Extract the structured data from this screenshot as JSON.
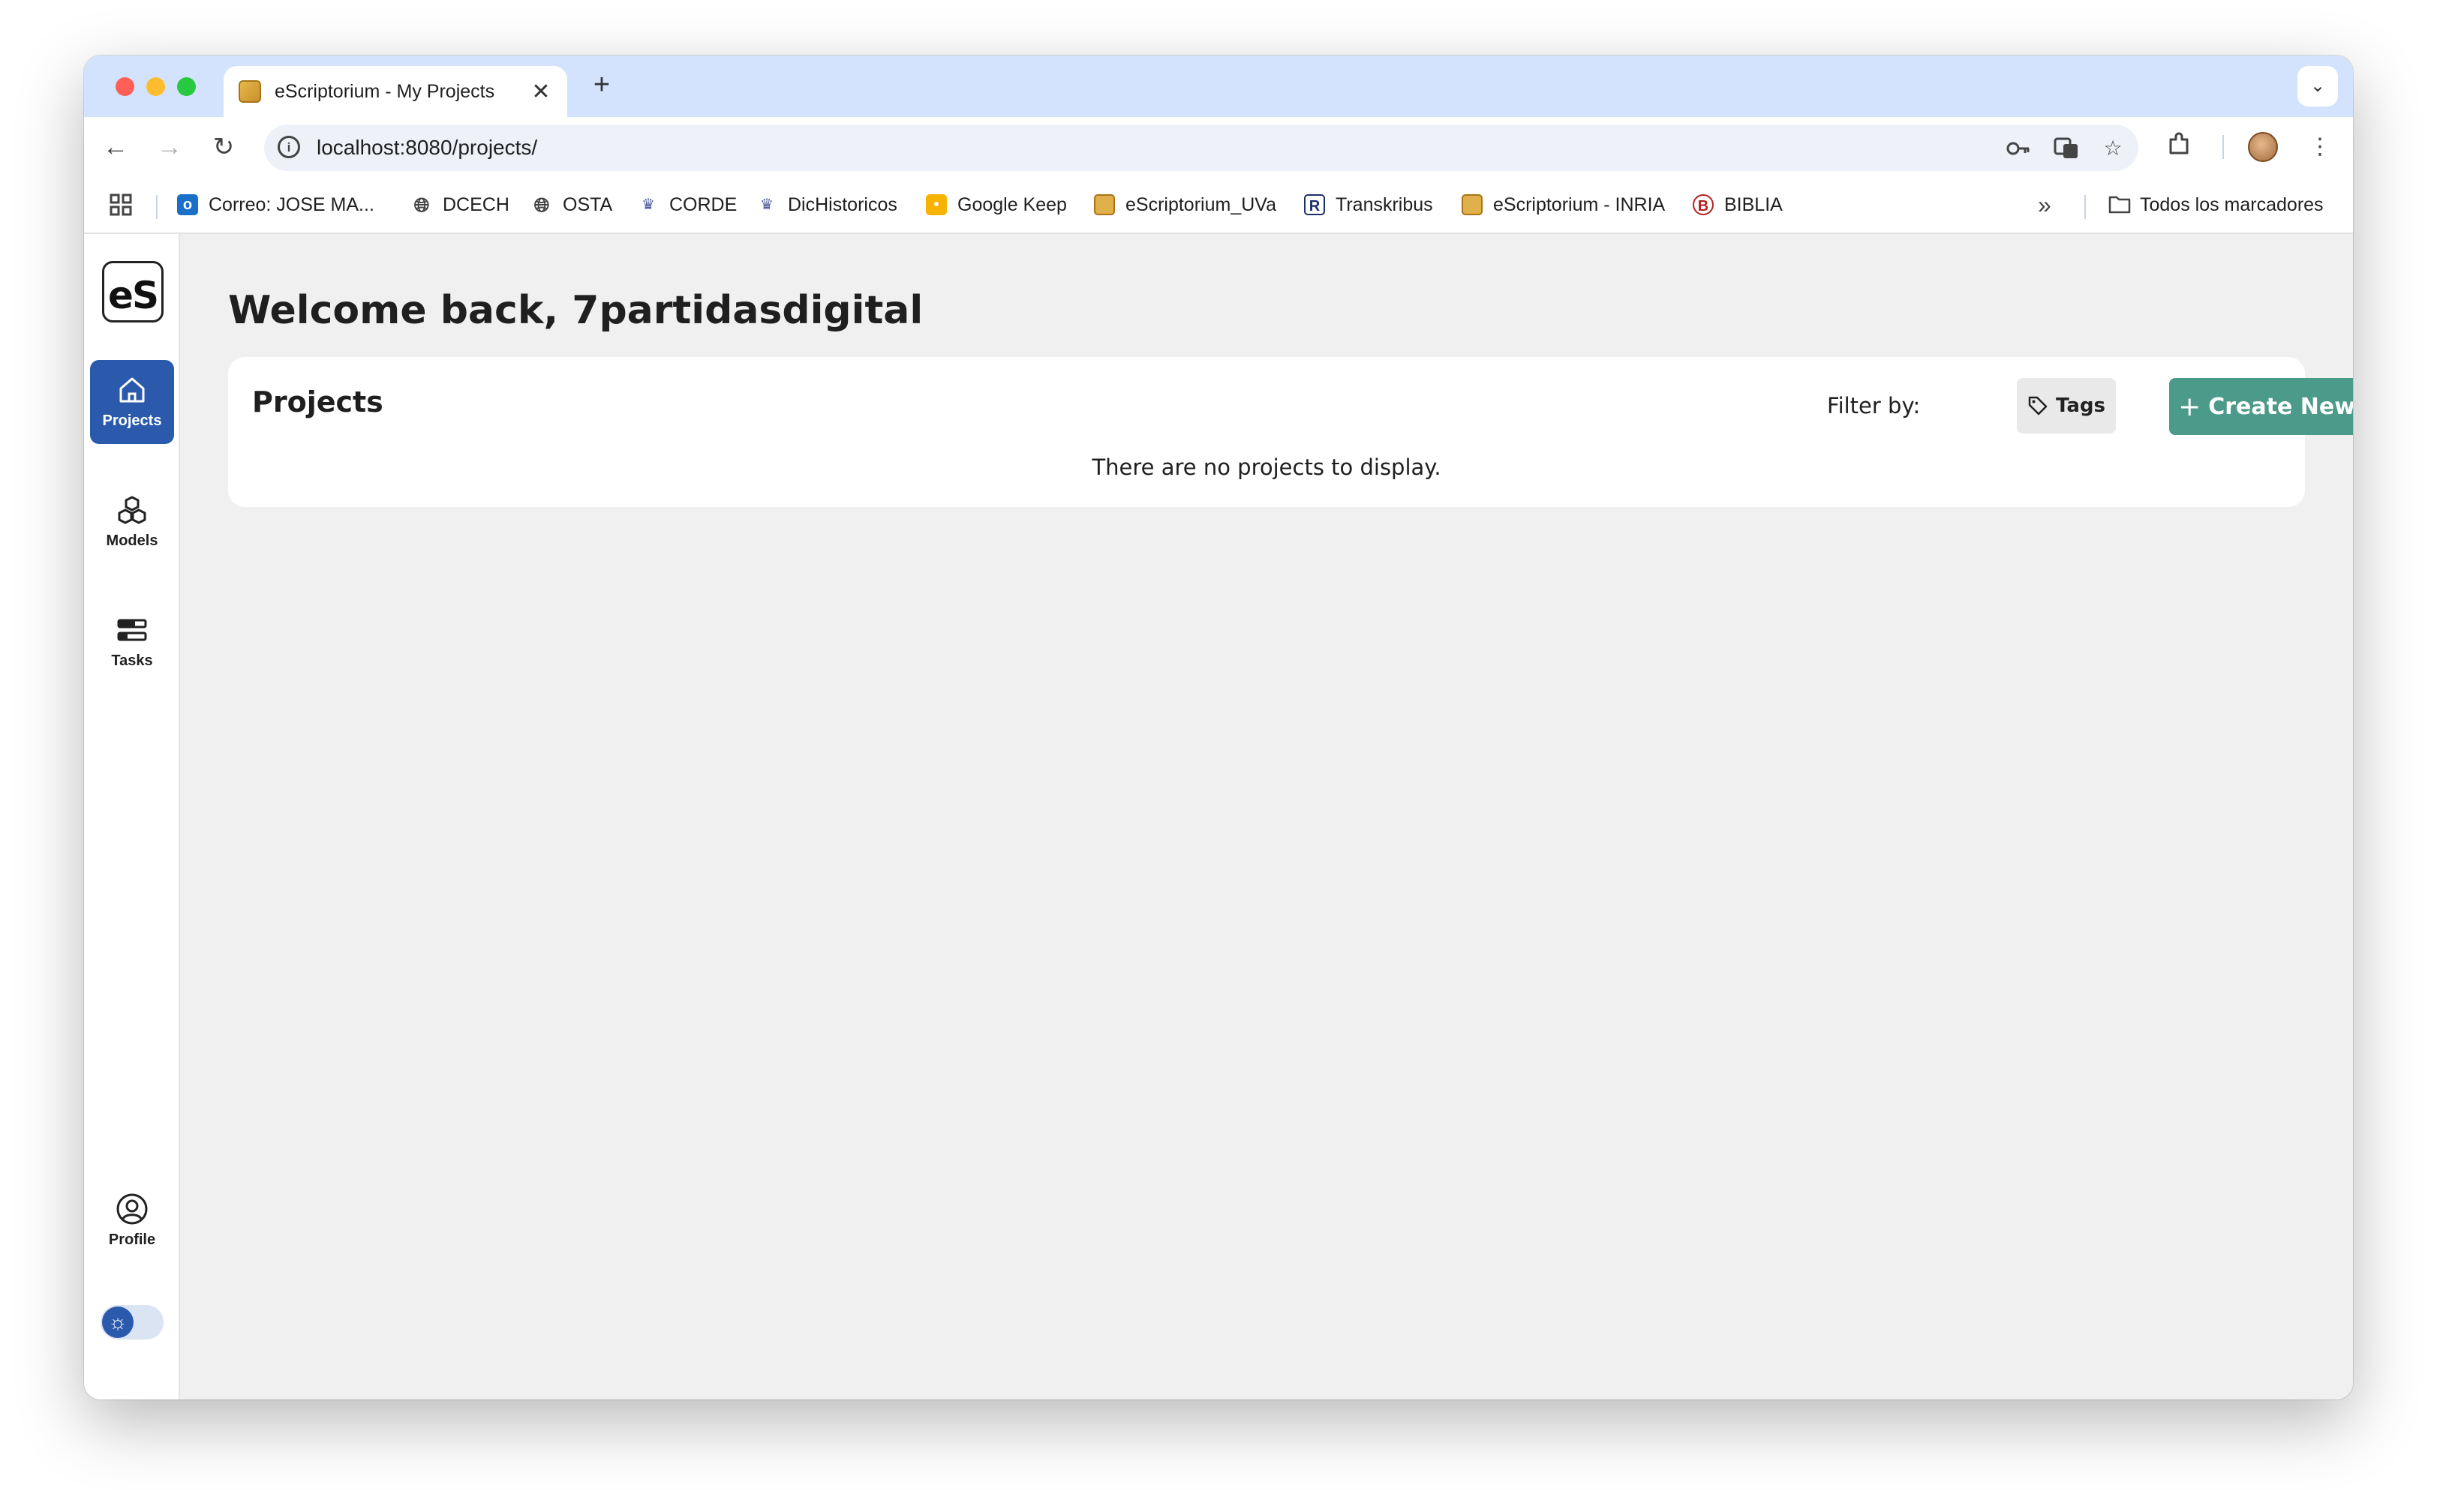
{
  "browser": {
    "tab_title": "eScriptorium - My Projects",
    "tab_close": "✕",
    "new_tab": "+",
    "tab_menu": "⌄",
    "url": "localhost:8080/projects/",
    "bookmarks": [
      {
        "label": "Correo: JOSE MA...",
        "icon": "outlook-icon"
      },
      {
        "label": "DCECH",
        "icon": "globe-icon"
      },
      {
        "label": "OSTA",
        "icon": "globe-icon"
      },
      {
        "label": "CORDE",
        "icon": "rae-icon"
      },
      {
        "label": "DicHistoricos",
        "icon": "rae-icon"
      },
      {
        "label": "Google Keep",
        "icon": "keep-icon"
      },
      {
        "label": "eScriptorium_UVa",
        "icon": "escriptorium-icon"
      },
      {
        "label": "Transkribus",
        "icon": "transkribus-icon"
      },
      {
        "label": "eScriptorium - INRIA",
        "icon": "escriptorium-icon"
      },
      {
        "label": "BIBLIA",
        "icon": "biblia-icon"
      }
    ],
    "more_bookmarks": "»",
    "all_bookmarks": "Todos los marcadores"
  },
  "sidebar": {
    "logo": "eS",
    "items": [
      {
        "label": "Projects",
        "icon": "home-icon",
        "active": true
      },
      {
        "label": "Models",
        "icon": "cubes-icon",
        "active": false
      },
      {
        "label": "Tasks",
        "icon": "tasks-icon",
        "active": false
      }
    ],
    "profile_label": "Profile",
    "theme_toggle_icon": "☼"
  },
  "main": {
    "welcome": "Welcome back, 7partidasdigital",
    "projects": {
      "title": "Projects",
      "filter_label": "Filter by:",
      "tags_label": "Tags",
      "create_label": "Create New",
      "create_plus": "+",
      "empty_message": "There are no projects to display."
    }
  },
  "colors": {
    "tabstrip": "#d3e3fd",
    "sidebar_active": "#2b5aad",
    "create_button": "#4c9a8a",
    "app_background": "#f0f0f0"
  }
}
